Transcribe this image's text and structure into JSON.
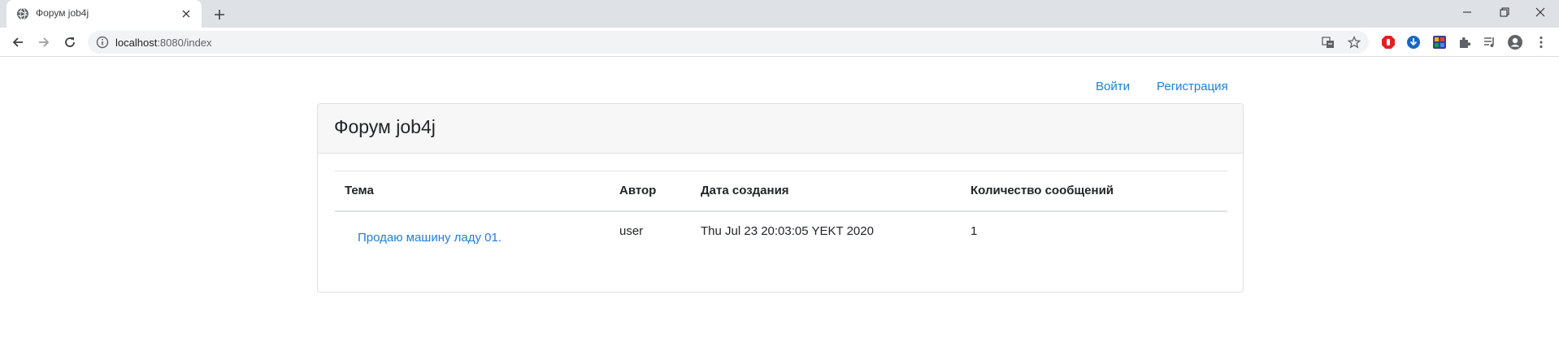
{
  "browser": {
    "tab_title": "Форум job4j",
    "url_host": "localhost",
    "url_rest": ":8080/index"
  },
  "nav": {
    "login": "Войти",
    "register": "Регистрация"
  },
  "forum": {
    "title": "Форум job4j",
    "columns": [
      "Тема",
      "Автор",
      "Дата создания",
      "Количество сообщений"
    ],
    "rows": [
      {
        "topic": "Продаю машину ладу 01.",
        "author": "user",
        "created": "Thu Jul 23 20:03:05 YEKT 2020",
        "messages": "1"
      }
    ]
  },
  "colors": {
    "link": "#1e7fe0",
    "chrome_bg": "#dee1e6",
    "card_header_bg": "#f7f7f7"
  }
}
